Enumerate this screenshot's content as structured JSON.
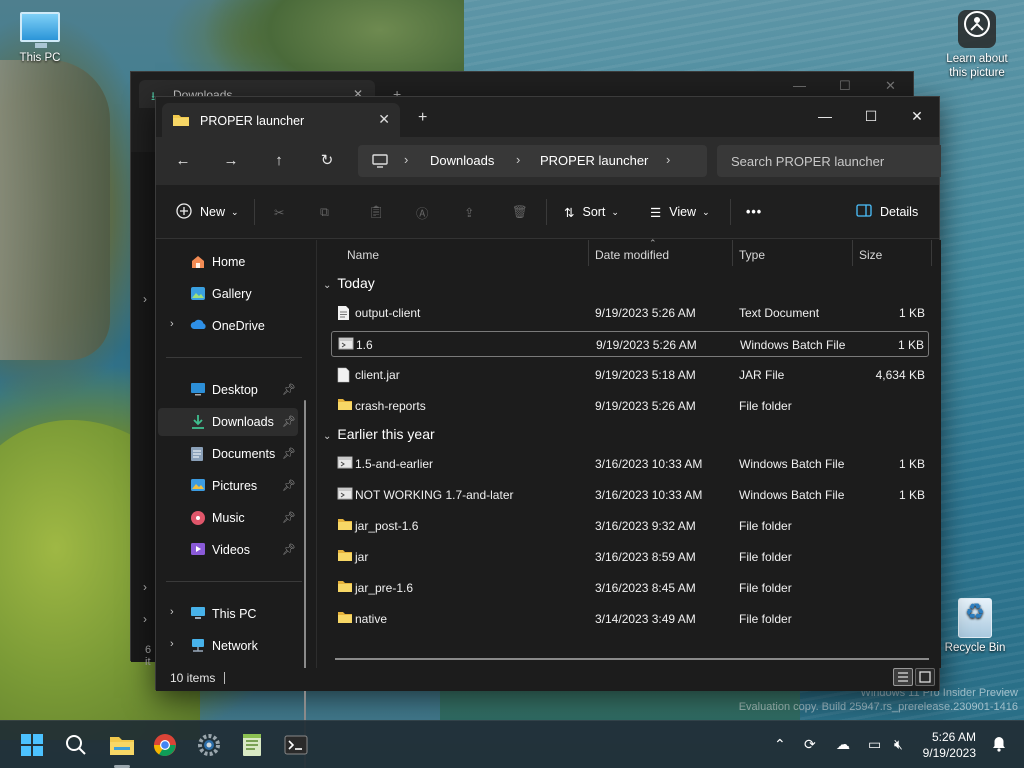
{
  "desktop": {
    "icons": {
      "this_pc": "This PC",
      "learn": "Learn about this picture",
      "recycle": "Recycle Bin"
    },
    "watermark": {
      "line1": "Windows 11 Pro Insider Preview",
      "line2": "Evaluation copy. Build 25947.rs_prerelease.230901-1416"
    }
  },
  "bg_window": {
    "tab_title": "Downloads",
    "status_prefix": "6 it"
  },
  "window": {
    "tab_title": "PROPER launcher",
    "breadcrumb": [
      "Downloads",
      "PROPER launcher"
    ],
    "search_placeholder": "Search PROPER launcher",
    "toolbar": {
      "new_label": "New",
      "sort_label": "Sort",
      "view_label": "View",
      "more_label": "•••",
      "details_label": "Details"
    },
    "nav": {
      "home": "Home",
      "gallery": "Gallery",
      "onedrive": "OneDrive",
      "desktop": "Desktop",
      "downloads": "Downloads",
      "documents": "Documents",
      "pictures": "Pictures",
      "music": "Music",
      "videos": "Videos",
      "this_pc": "This PC",
      "network": "Network"
    },
    "columns": {
      "name": "Name",
      "date": "Date modified",
      "type": "Type",
      "size": "Size"
    },
    "groups": {
      "today": "Today",
      "earlier": "Earlier this year"
    },
    "files_today": [
      {
        "name": "output-client",
        "date": "9/19/2023 5:26 AM",
        "type": "Text Document",
        "size": "1 KB",
        "icon": "text-file-icon"
      },
      {
        "name": "1.6",
        "date": "9/19/2023 5:26 AM",
        "type": "Windows Batch File",
        "size": "1 KB",
        "icon": "batch-file-icon"
      },
      {
        "name": "client.jar",
        "date": "9/19/2023 5:18 AM",
        "type": "JAR File",
        "size": "4,634 KB",
        "icon": "jar-file-icon"
      },
      {
        "name": "crash-reports",
        "date": "9/19/2023 5:26 AM",
        "type": "File folder",
        "size": "",
        "icon": "folder-icon"
      }
    ],
    "files_earlier": [
      {
        "name": "1.5-and-earlier",
        "date": "3/16/2023 10:33 AM",
        "type": "Windows Batch File",
        "size": "1 KB",
        "icon": "batch-file-icon"
      },
      {
        "name": "NOT WORKING 1.7-and-later",
        "date": "3/16/2023 10:33 AM",
        "type": "Windows Batch File",
        "size": "1 KB",
        "icon": "batch-file-icon"
      },
      {
        "name": "jar_post-1.6",
        "date": "3/16/2023 9:32 AM",
        "type": "File folder",
        "size": "",
        "icon": "folder-icon"
      },
      {
        "name": "jar",
        "date": "3/16/2023 8:59 AM",
        "type": "File folder",
        "size": "",
        "icon": "folder-icon"
      },
      {
        "name": "jar_pre-1.6",
        "date": "3/16/2023 8:45 AM",
        "type": "File folder",
        "size": "",
        "icon": "folder-icon"
      },
      {
        "name": "native",
        "date": "3/14/2023 3:49 AM",
        "type": "File folder",
        "size": "",
        "icon": "folder-icon"
      }
    ],
    "status": "10 items"
  },
  "taskbar": {
    "time": "5:26 AM",
    "date": "9/19/2023"
  },
  "colors": {
    "folder": "#f2c94c",
    "accent": "#4cc2ff",
    "downloads_green": "#3fbf8f"
  }
}
